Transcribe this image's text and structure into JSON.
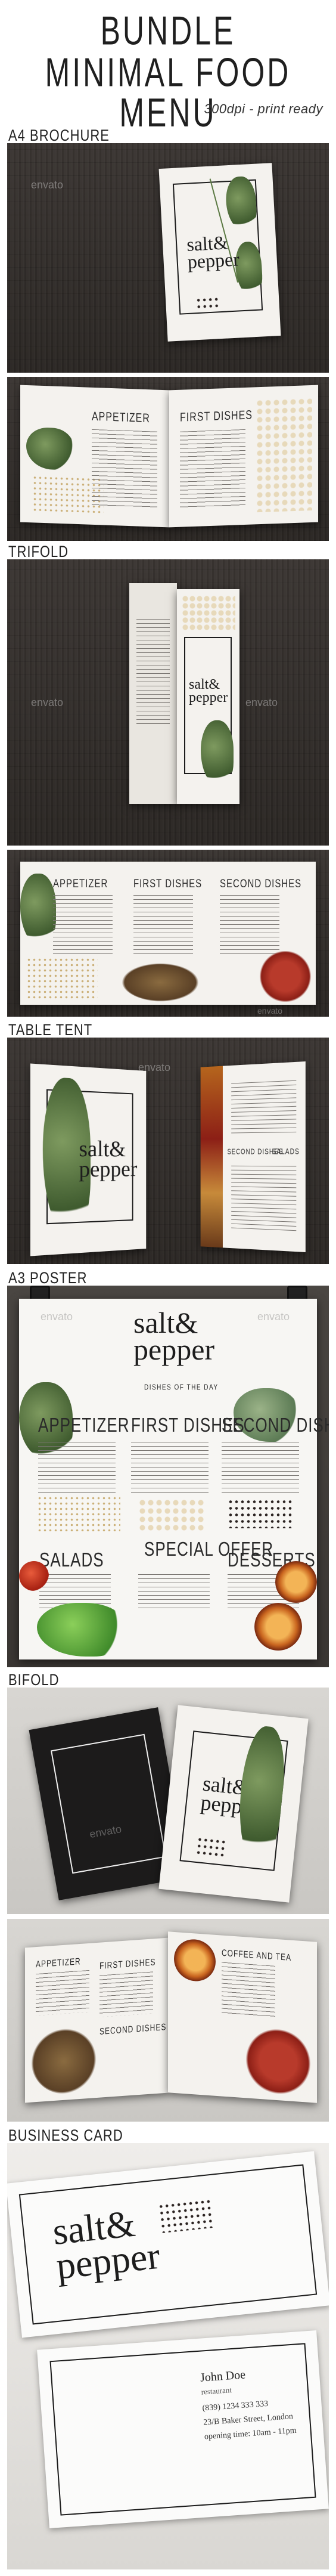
{
  "header": {
    "line1": "BUNDLE",
    "line2": "MINIMAL FOOD MENU",
    "subtitle": "300dpi - print ready"
  },
  "sections": {
    "a4": "A4 BROCHURE",
    "trifold": "TRIFOLD",
    "tabletent": "TABLE TENT",
    "a3": "A3 POSTER",
    "bifold": "BIFOLD",
    "businesscard": "BUSINESS CARD"
  },
  "watermark": "envato",
  "brand": {
    "line1": "salt",
    "amp": "&",
    "line2": "pepper"
  },
  "a4_spread": {
    "left_heading": "APPETIZER",
    "right_heading": "FIRST DISHES"
  },
  "trifold_spread": {
    "col1": "APPETIZER",
    "col2": "FIRST DISHES",
    "col3": "SECOND DISHES"
  },
  "tabletent": {
    "head1": "SECOND DISHES",
    "head2": "SALADS"
  },
  "poster": {
    "dishes_of_day": "DISHES OF THE DAY",
    "row1": [
      "APPETIZER",
      "FIRST DISHES",
      "SECOND DISHES"
    ],
    "row2": [
      "SALADS",
      "SPECIAL OFFER",
      "DESSERTS"
    ]
  },
  "bifold_spread": {
    "h1": "APPETIZER",
    "h2": "FIRST DISHES",
    "h3": "SECOND DISHES",
    "h4": "COFFEE AND TEA"
  },
  "card": {
    "name": "John Doe",
    "role": "restaurant",
    "phone": "(839) 1234 333 333",
    "address": "23/B Baker Street, London",
    "hours": "opening time: 10am - 11pm"
  },
  "colors": {
    "wood": "#2e2a27",
    "paper": "#f4f2ee",
    "ink": "#1d1d1d"
  }
}
